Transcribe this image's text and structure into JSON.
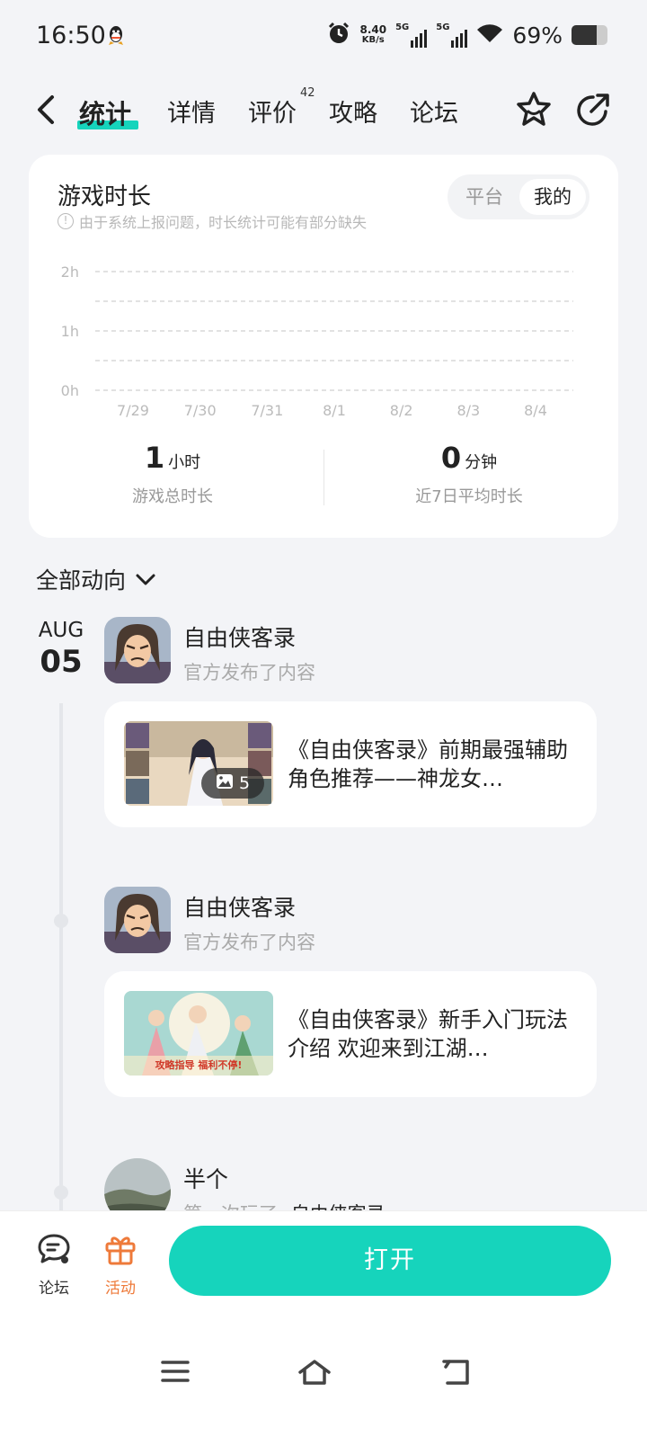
{
  "status_bar": {
    "time": "16:50",
    "speed_value": "8.40",
    "speed_unit": "KB/s",
    "sig1": "5G",
    "sig2": "5G",
    "battery": "69%",
    "icons": [
      "qq-icon",
      "alarm-icon",
      "signal-icon",
      "wifi-icon",
      "battery-icon"
    ]
  },
  "nav": {
    "tabs": [
      {
        "label": "统计",
        "active": true
      },
      {
        "label": "详情"
      },
      {
        "label": "评价"
      },
      {
        "label": "攻略"
      },
      {
        "label": "论坛"
      }
    ],
    "review_count": "42"
  },
  "stats": {
    "title": "游戏时长",
    "note": "由于系统上报问题，时长统计可能有部分缺失",
    "toggle_platform": "平台",
    "toggle_mine": "我的",
    "total_value": "1",
    "total_unit": "小时",
    "total_label": "游戏总时长",
    "avg_value": "0",
    "avg_unit": "分钟",
    "avg_label": "近7日平均时长"
  },
  "chart_data": {
    "type": "line",
    "categories": [
      "7/29",
      "7/30",
      "7/31",
      "8/1",
      "8/2",
      "8/3",
      "8/4"
    ],
    "yticks": [
      "2h",
      "1h",
      "0h"
    ],
    "ylim": [
      0,
      2
    ],
    "series": [
      {
        "values": [
          0,
          0,
          0,
          0,
          0,
          0,
          0
        ]
      }
    ]
  },
  "activity": {
    "filter_label": "全部动向",
    "date_month": "AUG",
    "date_day": "05",
    "items": [
      {
        "name": "自由侠客录",
        "sub": "官方发布了内容",
        "post_title": "《自由侠客录》前期最强辅助角色推荐——神龙女…",
        "image_count": "5"
      },
      {
        "name": "自由侠客录",
        "sub": "官方发布了内容",
        "post_title": "《自由侠客录》新手入门玩法介绍 欢迎来到江湖…",
        "banner_text": "攻略指导 福利不停!"
      },
      {
        "name": "半个",
        "sub_prefix": "第一次玩了",
        "sub_game": "自由侠客录"
      }
    ]
  },
  "bottom_bar": {
    "forum_label": "论坛",
    "event_label": "活动",
    "open_label": "打开"
  },
  "colors": {
    "accent": "#16d4bc",
    "event": "#ee7a3a",
    "background": "#f3f4f7"
  }
}
